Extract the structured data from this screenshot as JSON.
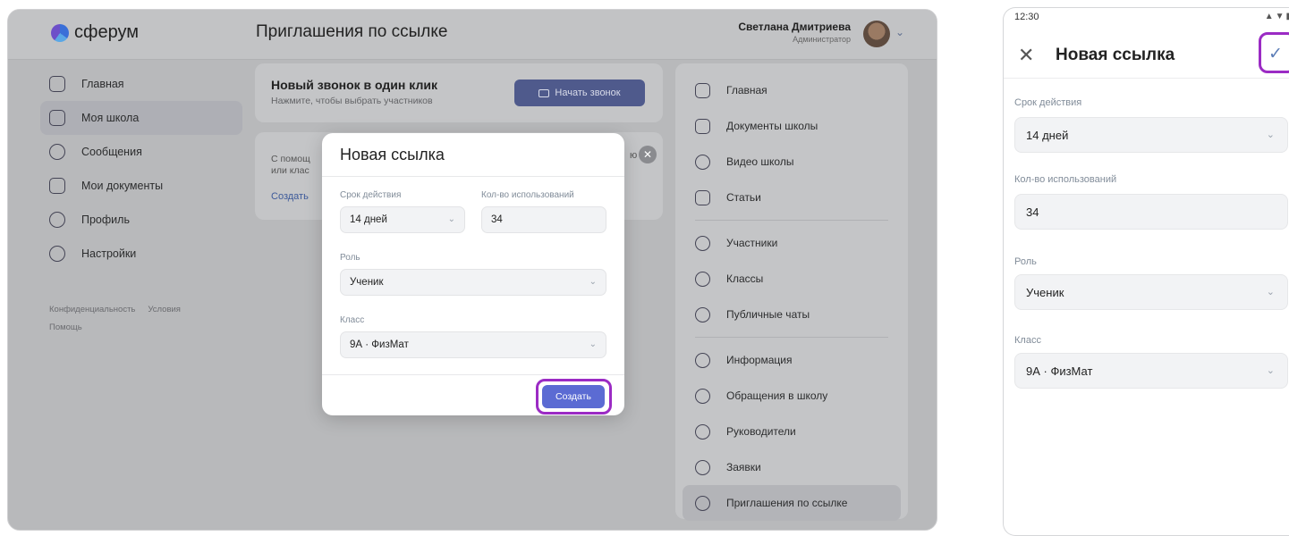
{
  "desktop": {
    "logo_text": "сферум",
    "header_title": "Приглашения по ссылке",
    "user": {
      "name": "Светлана Дмитриева",
      "role": "Администратор"
    },
    "sidebar": {
      "items": [
        {
          "label": "Главная",
          "icon": "grid-icon",
          "active": false
        },
        {
          "label": "Моя школа",
          "icon": "school-icon",
          "active": true
        },
        {
          "label": "Сообщения",
          "icon": "chat-icon",
          "active": false
        },
        {
          "label": "Мои документы",
          "icon": "document-icon",
          "active": false
        },
        {
          "label": "Профиль",
          "icon": "profile-icon",
          "active": false
        },
        {
          "label": "Настройки",
          "icon": "gear-icon",
          "active": false
        }
      ],
      "footer": {
        "privacy": "Конфиденциальность",
        "terms": "Условия",
        "help": "Помощь"
      }
    },
    "call_card": {
      "title": "Новый звонок в один клик",
      "subtitle": "Нажмите, чтобы выбрать участников",
      "button": "Начать звонок"
    },
    "invite_card": {
      "text": "С помощ... или клас...",
      "link": "Создать"
    },
    "right_panel": {
      "items": [
        {
          "label": "Главная",
          "icon": "home-icon",
          "active": false
        },
        {
          "label": "Документы школы",
          "icon": "document-icon",
          "active": false
        },
        {
          "label": "Видео школы",
          "icon": "video-icon",
          "active": false
        },
        {
          "label": "Статьи",
          "icon": "article-icon",
          "active": false
        },
        {
          "label": "Участники",
          "icon": "users-icon",
          "active": false
        },
        {
          "label": "Классы",
          "icon": "classes-icon",
          "active": false
        },
        {
          "label": "Публичные чаты",
          "icon": "public-chat-icon",
          "active": false
        },
        {
          "label": "Информация",
          "icon": "info-icon",
          "active": false
        },
        {
          "label": "Обращения в школу",
          "icon": "appeal-icon",
          "active": false
        },
        {
          "label": "Руководители",
          "icon": "leader-icon",
          "active": false
        },
        {
          "label": "Заявки",
          "icon": "request-icon",
          "active": false
        },
        {
          "label": "Приглашения по ссылке",
          "icon": "link-icon",
          "active": true
        }
      ]
    },
    "modal": {
      "title": "Новая ссылка",
      "validity_label": "Срок действия",
      "validity_value": "14 дней",
      "uses_label": "Кол-во использований",
      "uses_value": "34",
      "role_label": "Роль",
      "role_value": "Ученик",
      "class_label": "Класс",
      "class_value": "9А · ФизМат",
      "create_button": "Создать"
    }
  },
  "phone": {
    "status_time": "12:30",
    "title": "Новая ссылка",
    "validity_label": "Срок действия",
    "validity_value": "14 дней",
    "uses_label": "Кол-во использований",
    "uses_value": "34",
    "role_label": "Роль",
    "role_value": "Ученик",
    "class_label": "Класс",
    "class_value": "9А · ФизМат"
  },
  "colors": {
    "accent": "#5b6bd3",
    "highlight": "#9b2bc4",
    "overlay": "#b8b9bb"
  }
}
